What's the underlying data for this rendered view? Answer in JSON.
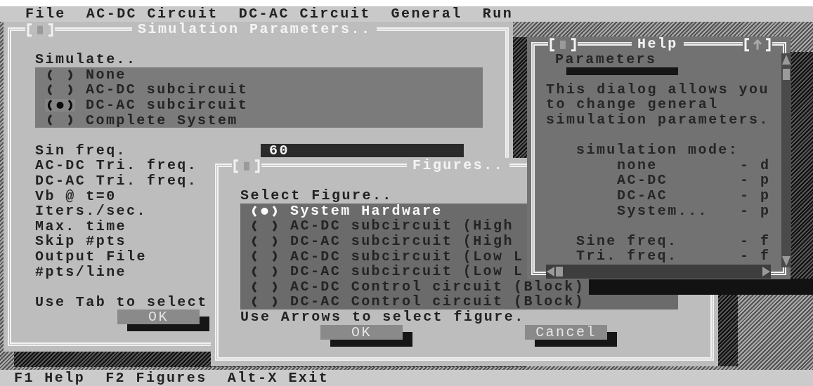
{
  "menu": [
    {
      "label": "File"
    },
    {
      "label": "AC-DC Circuit"
    },
    {
      "label": "DC-AC Circuit"
    },
    {
      "label": "General"
    },
    {
      "label": "Run"
    }
  ],
  "simulation_window": {
    "title": "Simulation Parameters..",
    "group_label": "Simulate..",
    "focused": false,
    "options": [
      {
        "label": "None",
        "selected": false
      },
      {
        "label": "AC-DC subcircuit",
        "selected": false
      },
      {
        "label": "DC-AC subcircuit",
        "selected": true
      },
      {
        "label": "Complete System",
        "selected": false
      }
    ],
    "fields": [
      {
        "label": "Sin freq.",
        "value": "60"
      },
      {
        "label": "AC-DC Tri. freq."
      },
      {
        "label": "DC-AC Tri. freq."
      },
      {
        "label": "Vb @ t=0"
      },
      {
        "label": "Iters./sec."
      },
      {
        "label": "Max. time"
      },
      {
        "label": "Skip #pts"
      },
      {
        "label": "Output File"
      },
      {
        "label": "#pts/line"
      }
    ],
    "hint": "Use Tab to select",
    "buttons": [
      {
        "label": "OK"
      }
    ]
  },
  "figures_window": {
    "title": "Figures..",
    "group_label": "Select Figure..",
    "focused": true,
    "options": [
      {
        "label": "System Hardware",
        "selected": true
      },
      {
        "label": "AC-DC subcircuit (High",
        "selected": false
      },
      {
        "label": "DC-AC subcircuit (High",
        "selected": false
      },
      {
        "label": "AC-DC subcircuit (Low L",
        "selected": false
      },
      {
        "label": "DC-AC subcircuit (Low L",
        "selected": false
      },
      {
        "label": "AC-DC Control circuit (Block)",
        "selected": false
      },
      {
        "label": "DC-AC Control circuit (Block)",
        "selected": false
      }
    ],
    "hint": "Use Arrows to select figure.",
    "buttons": [
      {
        "label": "OK"
      },
      {
        "label": "Cancel"
      }
    ]
  },
  "help_window": {
    "title": "Help",
    "topic": "Parameters",
    "paragraph": "This dialog allows you to change general simulation parameters.",
    "sections": [
      {
        "heading": "simulation mode:",
        "entries": [
          {
            "term": "none",
            "key": "- d"
          },
          {
            "term": "AC-DC",
            "key": "- p"
          },
          {
            "term": "DC-AC",
            "key": "- p"
          },
          {
            "term": "System...",
            "key": "- p"
          }
        ]
      },
      {
        "entries": [
          {
            "term": "Sine freq.",
            "key": "- f"
          },
          {
            "term": "Tri. freq.",
            "key": "- f"
          }
        ]
      }
    ]
  },
  "status_bar": [
    {
      "text": "F1 Help"
    },
    {
      "text": "F2 Figures"
    },
    {
      "text": "Alt-X Exit"
    }
  ]
}
